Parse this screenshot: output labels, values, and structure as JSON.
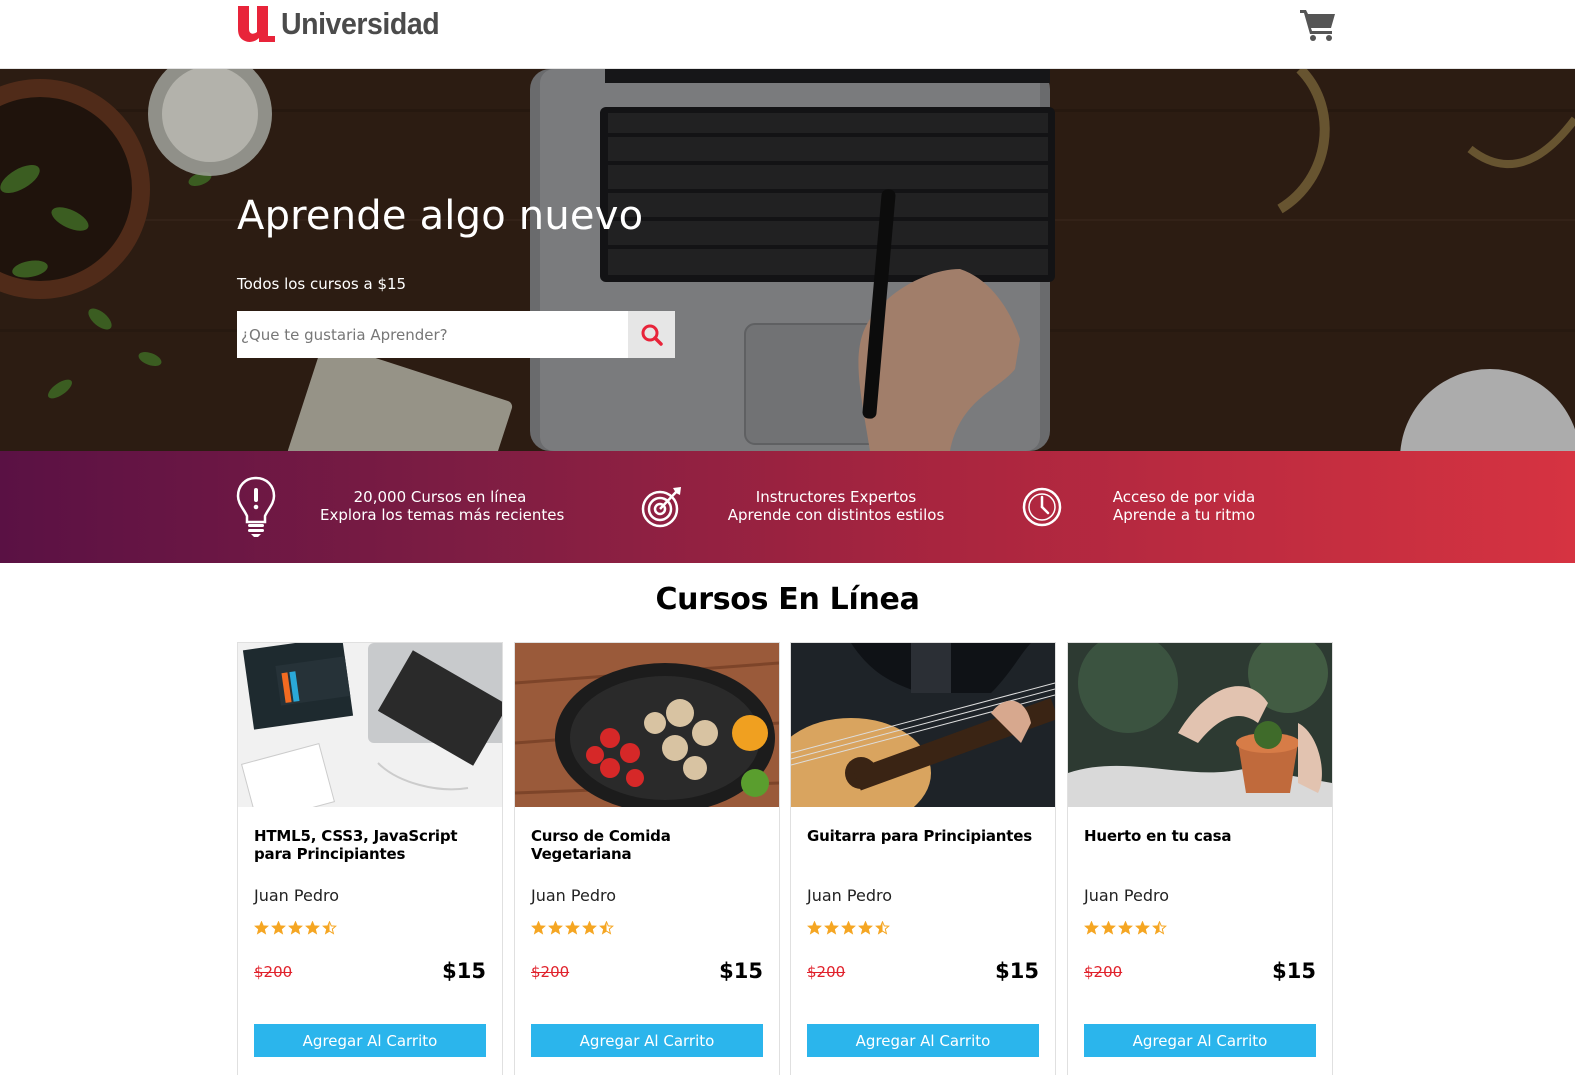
{
  "header": {
    "logo_text": "Universidad",
    "brand_color": "#e8243a",
    "cart_icon": "shopping-cart-icon"
  },
  "hero": {
    "title": "Aprende algo nuevo",
    "subtitle": "Todos los cursos a $15",
    "search_placeholder": "¿Que te gustaria Aprender?",
    "search_icon": "search-icon"
  },
  "features": [
    {
      "icon": "lightbulb-icon",
      "line1": "20,000 Cursos en línea",
      "line2": "Explora los temas más recientes"
    },
    {
      "icon": "target-icon",
      "line1": "Instructores Expertos",
      "line2": "Aprende con distintos estilos"
    },
    {
      "icon": "clock-icon",
      "line1": "Acceso de por vida",
      "line2": "Aprende a tu ritmo"
    }
  ],
  "courses_section": {
    "title": "Cursos En Línea",
    "button_color": "#2bb5ec",
    "cards": [
      {
        "image": "html-css-book-laptop",
        "title": "HTML5, CSS3, JavaScript para Principiantes",
        "author": "Juan Pedro",
        "rating": 4.5,
        "old_price": "$200",
        "price": "$15",
        "button": "Agregar Al Carrito"
      },
      {
        "image": "vegetables-pan",
        "title": "Curso de Comida Vegetariana",
        "author": "Juan Pedro",
        "rating": 4.5,
        "old_price": "$200",
        "price": "$15",
        "button": "Agregar Al Carrito"
      },
      {
        "image": "acoustic-guitar",
        "title": "Guitarra para Principiantes",
        "author": "Juan Pedro",
        "rating": 4.5,
        "old_price": "$200",
        "price": "$15",
        "button": "Agregar Al Carrito"
      },
      {
        "image": "hands-plant-pot",
        "title": "Huerto en tu casa",
        "author": "Juan Pedro",
        "rating": 4.5,
        "old_price": "$200",
        "price": "$15",
        "button": "Agregar Al Carrito"
      }
    ]
  }
}
